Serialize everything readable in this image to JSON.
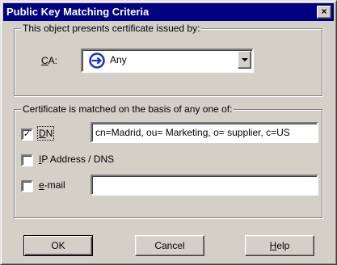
{
  "dialog": {
    "title": "Public Key Matching Criteria",
    "close_glyph": "×"
  },
  "issuer_group": {
    "legend": "This object presents certificate issued by:",
    "ca_label_mnemonic": "C",
    "ca_label_rest": "A:",
    "ca_value": "Any",
    "ca_icon": "ca-any-icon"
  },
  "match_group": {
    "legend": "Certificate is matched on the basis of any one of:",
    "dn": {
      "checked": true,
      "label_mnemonic": "D",
      "label_rest": "N",
      "value": "cn=Madrid, ou= Marketing, o= supplier, c=US"
    },
    "ip": {
      "checked": false,
      "label_mnemonic": "I",
      "label_rest": "P Address / DNS"
    },
    "email": {
      "checked": false,
      "label_mnemonic": "e",
      "label_rest": "-mail",
      "value": ""
    }
  },
  "buttons": {
    "ok": "OK",
    "cancel": "Cancel",
    "help_mnemonic": "H",
    "help_rest": "elp"
  },
  "colors": {
    "titlebar": "#000080",
    "face": "#d4d0c8",
    "ca_icon": "#1a2fcf"
  },
  "check_glyph": "✓"
}
